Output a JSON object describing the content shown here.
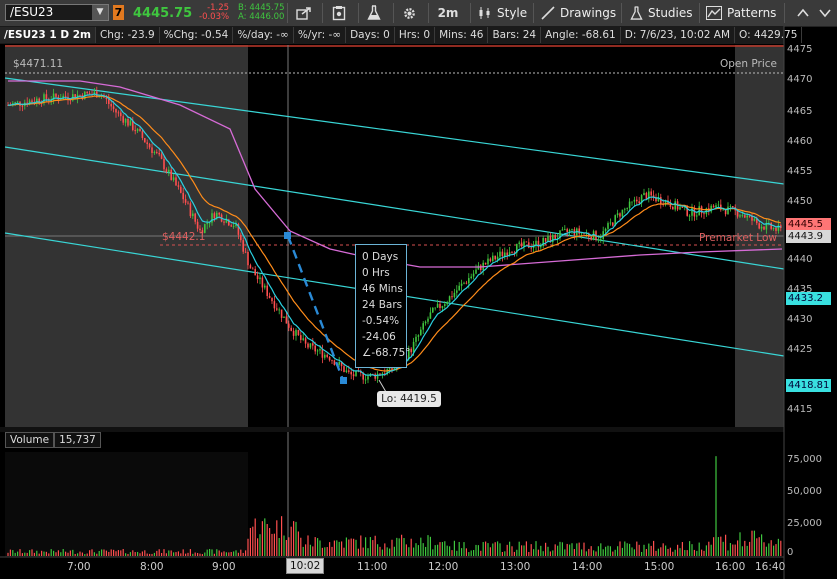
{
  "toolbar": {
    "symbol": "/ESU23",
    "alert_badge": "7",
    "last_price": "4445.75",
    "net_change": "-1.25",
    "pct_change": "-0.03%",
    "bid": "B: 4445.75",
    "ask": "A: 4446.00",
    "interval": "2m",
    "style_label": "Style",
    "drawings_label": "Drawings",
    "studies_label": "Studies",
    "patterns_label": "Patterns"
  },
  "infobar": {
    "title": "/ESU23 1 D 2m",
    "chg": "Chg: -23.9",
    "pct_chg": "%Chg: -0.54",
    "per_day": "%/day: -∞",
    "per_yr": "%/yr: -∞",
    "days": "Days: 0",
    "hrs": "Hrs: 0",
    "mins": "Mins: 46",
    "bars": "Bars: 24",
    "angle": "Angle: -68.61",
    "datetime": "D: 7/6/23, 10:02 AM",
    "open": "O: 4429.75"
  },
  "price_axis": {
    "labels": [
      "4475",
      "4470",
      "4465",
      "4460",
      "4455",
      "4450",
      "4445",
      "4440",
      "4435",
      "4430",
      "4425",
      "4420",
      "4415"
    ]
  },
  "price_tags": {
    "last": "4445.5",
    "cursor": "4443.9",
    "level_1": "4433.2",
    "level_2": "4418.81"
  },
  "chart_annotations": {
    "open_price_label": "Open Price",
    "open_price_value": "$4471.11",
    "premarket_low_label": "Premarket Low",
    "premarket_low_value": "$4442.1",
    "low_callout": "Lo: 4419.5"
  },
  "measure_popup": {
    "lines": [
      "0 Days",
      "0 Hrs",
      "46 Mins",
      "24 Bars",
      "-0.54%",
      "-24.06",
      "∠-68.75°"
    ]
  },
  "volume": {
    "label": "Volume",
    "value": "15,737",
    "axis_labels": [
      "75,000",
      "50,000",
      "25,000",
      "0"
    ]
  },
  "time_axis": {
    "labels": [
      "7:00",
      "8:00",
      "9:00",
      "10:02",
      "11:00",
      "12:00",
      "13:00",
      "14:00",
      "15:00",
      "16:00",
      "16:40"
    ]
  },
  "colors": {
    "price_up": "#3fc63f",
    "price_down": "#ff4f4f",
    "ema_fast": "#2ad0e0",
    "ema_slow": "#ff8c1a",
    "vwap": "#d66bd6",
    "channel": "#39d6d6",
    "measure": "#2a8ad6"
  }
}
